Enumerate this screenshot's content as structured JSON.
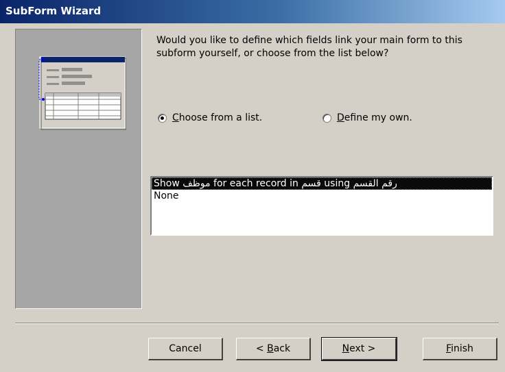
{
  "window": {
    "title": "SubForm Wizard"
  },
  "prompt": "Would you like to define which fields link your main form to this subform yourself, or choose from the list below?",
  "radio_options": [
    {
      "key": "C",
      "rest": "hoose from a list.",
      "label": "Choose from a list.",
      "checked": true
    },
    {
      "key": "D",
      "rest": "efine my own.",
      "label": "Define my own.",
      "checked": false
    }
  ],
  "link_list": {
    "items": [
      "Show موظف for each record in قسم using رقم القسم",
      "None"
    ],
    "selected_index": 0
  },
  "buttons": {
    "cancel": "Cancel",
    "back_pre": "< ",
    "back_key": "B",
    "back_rest": "ack",
    "next_key": "N",
    "next_rest": "ext >",
    "finish_key": "F",
    "finish_rest": "inish"
  },
  "colors": {
    "title_gradient_start": "#0a246a",
    "title_gradient_end": "#a6caf0",
    "dialog_face": "#d4d0c8",
    "side_panel": "#a6a6a6",
    "selection": "#0a0a0a"
  },
  "icons": [
    "radio-checked-icon",
    "radio-unchecked-icon",
    "form-subform-preview-illustration"
  ]
}
